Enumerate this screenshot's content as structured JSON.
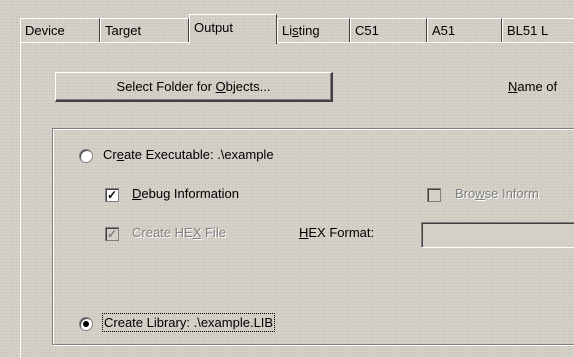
{
  "tabs": [
    {
      "label_pre": "Device",
      "u": "",
      "label_post": ""
    },
    {
      "label_pre": "Target",
      "u": "",
      "label_post": ""
    },
    {
      "label_pre": "Output",
      "u": "",
      "label_post": ""
    },
    {
      "label_pre": "Li",
      "u": "s",
      "label_post": "ting"
    },
    {
      "label_pre": "C51",
      "u": "",
      "label_post": ""
    },
    {
      "label_pre": "A51",
      "u": "",
      "label_post": ""
    },
    {
      "label_pre": "BL51 L",
      "u": "",
      "label_post": ""
    }
  ],
  "active_tab": "Output",
  "select_folder": {
    "pre": "Select Folder for ",
    "u": "O",
    "post": "bjects..."
  },
  "name_of": {
    "u": "N",
    "post": "ame of"
  },
  "create_executable": {
    "pre": "Cr",
    "u": "e",
    "post": "ate Executable:",
    "value": " .\\example",
    "checked": false
  },
  "debug_info": {
    "u": "D",
    "post": "ebug Information",
    "checked": true
  },
  "browse_info": {
    "pre": "Bro",
    "u": "w",
    "post": "se Inform",
    "checked": false,
    "enabled": false
  },
  "create_hex": {
    "pre": "Create HE",
    "u": "X",
    "post": " File",
    "checked": true,
    "enabled": false
  },
  "hex_format": {
    "u": "H",
    "post": "EX Format:",
    "value": ""
  },
  "create_library": {
    "label": "Create Library:",
    "value": " .\\example.LIB",
    "checked": true
  },
  "check_glyph": "✓"
}
